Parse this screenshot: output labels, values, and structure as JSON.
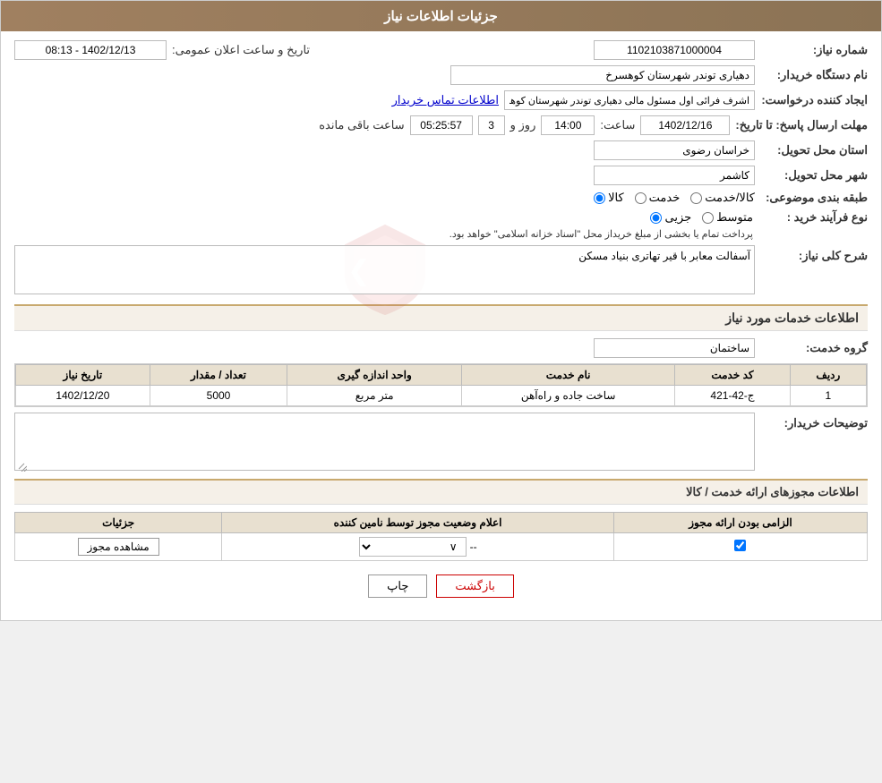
{
  "header": {
    "title": "جزئیات اطلاعات نیاز"
  },
  "fields": {
    "need_number_label": "شماره نیاز:",
    "need_number_value": "1102103871000004",
    "buyer_org_label": "نام دستگاه خریدار:",
    "buyer_org_value": "دهیاری توندر شهرستان کوهسرخ",
    "announcement_datetime_label": "تاریخ و ساعت اعلان عمومی:",
    "announcement_datetime_value": "1402/12/13 - 08:13",
    "creator_label": "ایجاد کننده درخواست:",
    "creator_value": "اشرف فرائی اول مسئول مالی دهیاری توندر شهرستان کوهسرخ",
    "contact_info_link": "اطلاعات تماس خریدار",
    "send_deadline_label": "مهلت ارسال پاسخ: تا تاریخ:",
    "send_date": "1402/12/16",
    "send_time_label": "ساعت:",
    "send_time": "14:00",
    "send_days_label": "روز و",
    "send_days": "3",
    "send_remaining_label": "ساعت باقی مانده",
    "send_remaining": "05:25:57",
    "delivery_province_label": "استان محل تحویل:",
    "delivery_province": "خراسان رضوی",
    "delivery_city_label": "شهر محل تحویل:",
    "delivery_city": "کاشمر",
    "category_label": "طبقه بندی موضوعی:",
    "category_options": [
      "کالا",
      "خدمت",
      "کالا/خدمت"
    ],
    "category_selected": "کالا",
    "process_type_label": "نوع فرآیند خرید :",
    "process_type_options": [
      "جزیی",
      "متوسط"
    ],
    "process_type_selected": "متوسط",
    "process_note": "پرداخت تمام یا بخشی از مبلغ خریداز محل \"اسناد خزانه اسلامی\" خواهد بود.",
    "need_description_label": "شرح کلی نیاز:",
    "need_description_value": "آسفالت معابر با قیر تهاتری بنیاد مسکن",
    "services_section_title": "اطلاعات خدمات مورد نیاز",
    "service_group_label": "گروه خدمت:",
    "service_group_value": "ساختمان",
    "table_headers": {
      "row_num": "ردیف",
      "service_code": "کد خدمت",
      "service_name": "نام خدمت",
      "unit": "واحد اندازه گیری",
      "quantity": "تعداد / مقدار",
      "need_date": "تاریخ نیاز"
    },
    "table_rows": [
      {
        "row_num": "1",
        "service_code": "ج-42-421",
        "service_name": "ساخت جاده و راه‌آهن",
        "unit": "متر مربع",
        "quantity": "5000",
        "need_date": "1402/12/20"
      }
    ],
    "buyer_notes_label": "توضیحات خریدار:",
    "licenses_section_title": "اطلاعات مجوزهای ارائه خدمت / کالا",
    "license_table_headers": {
      "mandatory": "الزامی بودن ارائه مجوز",
      "status": "اعلام وضعیت مجوز توسط نامین کننده",
      "details": "جزئیات"
    },
    "license_rows": [
      {
        "mandatory": true,
        "status": "--",
        "details_label": "مشاهده مجوز"
      }
    ]
  },
  "buttons": {
    "print_label": "چاپ",
    "back_label": "بازگشت"
  }
}
